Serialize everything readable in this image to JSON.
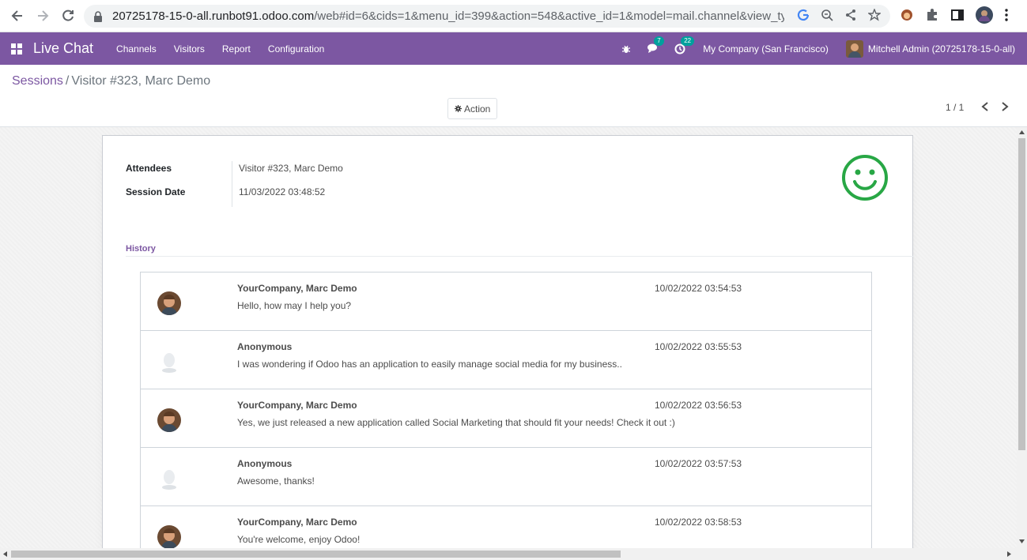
{
  "browser": {
    "url_host": "20725178-15-0-all.runbot91.odoo.com",
    "url_rest": "/web#id=6&cids=1&menu_id=399&action=548&active_id=1&model=mail.channel&view_type..."
  },
  "navbar": {
    "app_name": "Live Chat",
    "menu": [
      "Channels",
      "Visitors",
      "Report",
      "Configuration"
    ],
    "messages_count": "7",
    "activities_count": "22",
    "company": "My Company (San Francisco)",
    "user": "Mitchell Admin (20725178-15-0-all)",
    "color": "#7c57a2"
  },
  "control_panel": {
    "breadcrumb_parent": "Sessions",
    "breadcrumb_separator": "/",
    "breadcrumb_current": "Visitor #323, Marc Demo",
    "action_label": "Action",
    "pager": "1 / 1"
  },
  "form": {
    "attendees_label": "Attendees",
    "attendees_value": "Visitor #323, Marc Demo",
    "session_date_label": "Session Date",
    "session_date_value": "11/03/2022 03:48:52",
    "rating_icon": "smiley-happy-icon",
    "rating_color": "#28a745",
    "history_label": "History"
  },
  "messages": [
    {
      "author": "YourCompany, Marc Demo",
      "date": "10/02/2022 03:54:53",
      "body": "Hello, how may I help you?",
      "avatar": "operator"
    },
    {
      "author": "Anonymous",
      "date": "10/02/2022 03:55:53",
      "body": "I was wondering if Odoo has an application to easily manage social media for my business..",
      "avatar": "anonymous"
    },
    {
      "author": "YourCompany, Marc Demo",
      "date": "10/02/2022 03:56:53",
      "body": "Yes, we just released a new application called Social Marketing that should fit your needs! Check it out :)",
      "avatar": "operator"
    },
    {
      "author": "Anonymous",
      "date": "10/02/2022 03:57:53",
      "body": "Awesome, thanks!",
      "avatar": "anonymous"
    },
    {
      "author": "YourCompany, Marc Demo",
      "date": "10/02/2022 03:58:53",
      "body": "You're welcome, enjoy Odoo!",
      "avatar": "operator"
    }
  ]
}
